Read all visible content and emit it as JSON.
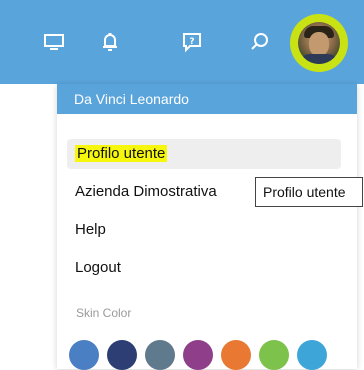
{
  "topbar": {
    "icons": [
      "monitor-icon",
      "bell-icon",
      "chat-help-icon",
      "search-icon"
    ],
    "bg_color": "#5aa4dc",
    "avatar_ring_color": "#c9e214"
  },
  "user_menu": {
    "header": "Da Vinci Leonardo",
    "items": [
      {
        "label": "Profilo utente",
        "highlight": true
      },
      {
        "label": "Azienda Dimostrativa"
      },
      {
        "label": "Help"
      },
      {
        "label": "Logout"
      }
    ],
    "skin_color_label": "Skin Color",
    "skin_colors": [
      "#4a7fc4",
      "#2c3e74",
      "#5f7a8c",
      "#8f3f8a",
      "#e87832",
      "#7dc24a",
      "#3ea5d8"
    ]
  },
  "tooltip": {
    "text": "Profilo utente"
  }
}
